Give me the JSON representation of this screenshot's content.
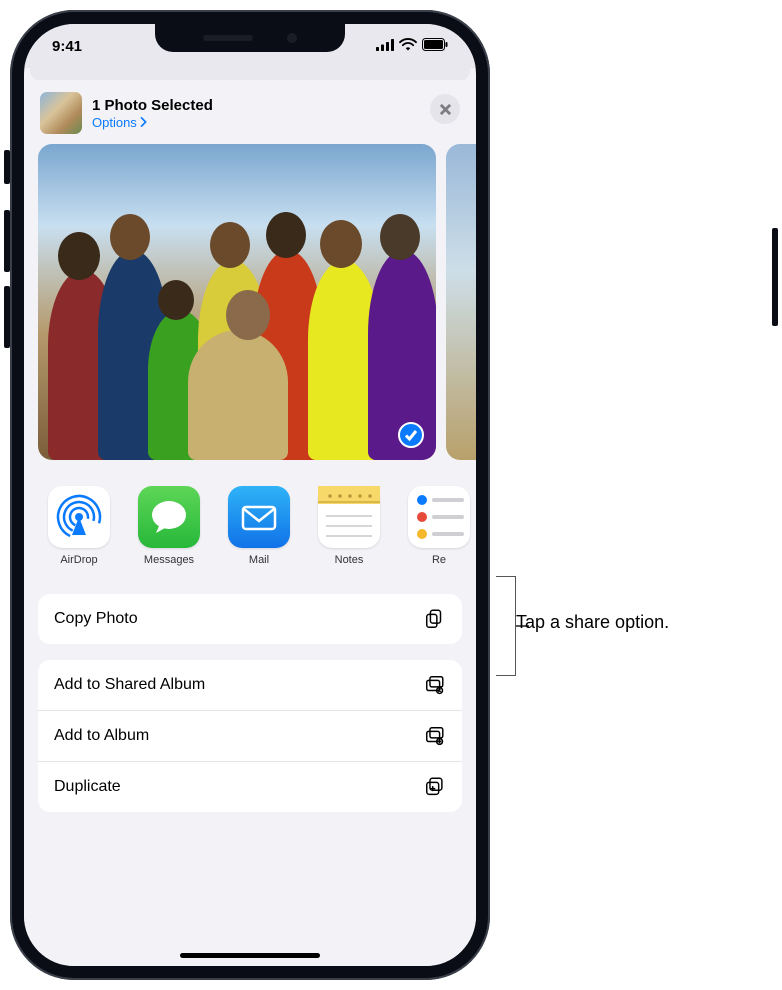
{
  "status": {
    "time": "9:41"
  },
  "header": {
    "title": "1 Photo Selected",
    "options_label": "Options"
  },
  "apps": [
    {
      "name": "AirDrop"
    },
    {
      "name": "Messages"
    },
    {
      "name": "Mail"
    },
    {
      "name": "Notes"
    },
    {
      "name": "Re"
    }
  ],
  "actions": {
    "copy": "Copy Photo",
    "shared_album": "Add to Shared Album",
    "album": "Add to Album",
    "duplicate": "Duplicate"
  },
  "annotation": "Tap a share option."
}
